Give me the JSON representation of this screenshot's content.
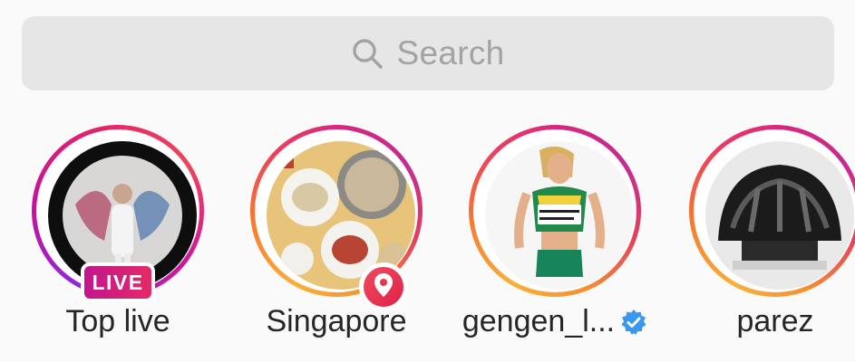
{
  "search": {
    "placeholder": "Search",
    "icon": "search-icon"
  },
  "stories": [
    {
      "label": "Top live",
      "badge": "LIVE",
      "ring": "live",
      "avatar_icon": "person-with-wings-photo"
    },
    {
      "label": "Singapore",
      "badge_icon": "location-pin-icon",
      "ring": "gradient",
      "avatar_icon": "food-table-photo"
    },
    {
      "label": "gengen_l...",
      "verified": true,
      "badge_icon": "verified-badge-icon",
      "ring": "gradient",
      "avatar_icon": "athlete-photo"
    },
    {
      "label": "parez",
      "ring": "gradient",
      "avatar_icon": "bike-helmet-photo"
    }
  ],
  "colors": {
    "background": "#fafafa",
    "search_bg": "#e6e6e6",
    "placeholder": "#a3a3a3",
    "text": "#262626",
    "verified": "#3897f0",
    "live_badge": "#d6196f"
  }
}
